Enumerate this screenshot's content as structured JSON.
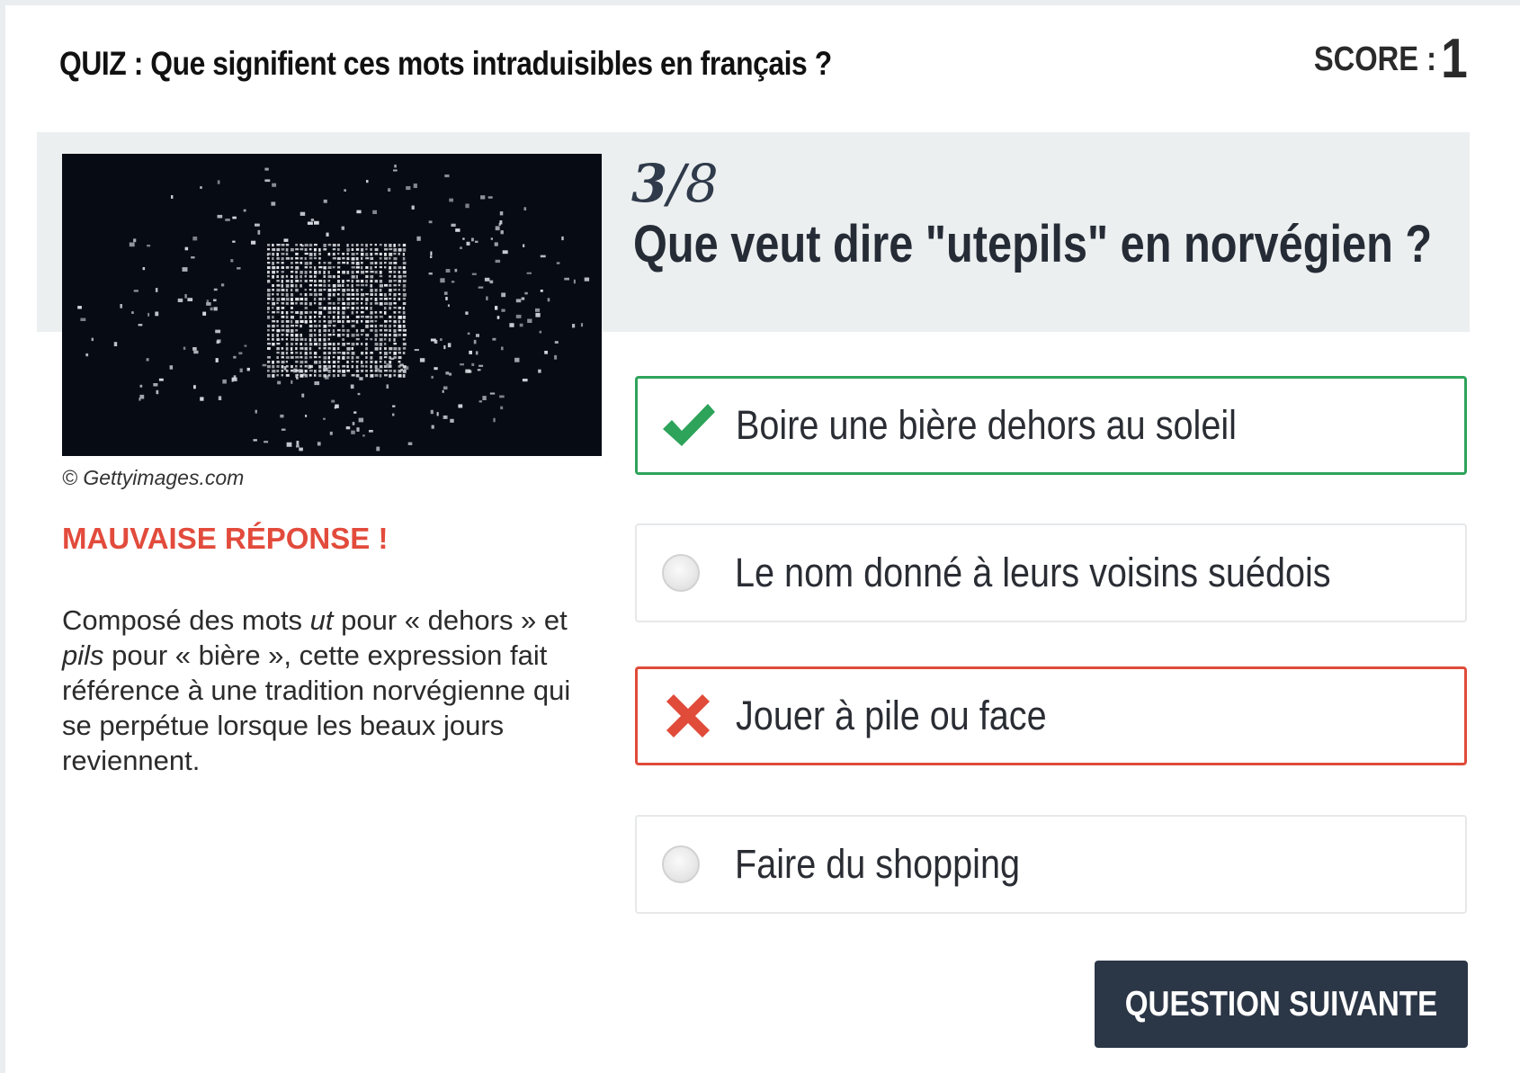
{
  "quiz": {
    "title": "QUIZ : Que signifient ces mots intraduisibles en français ?",
    "score_label": "SCORE :",
    "score_value": "1"
  },
  "question": {
    "current": "3",
    "total": "/8",
    "text": "Que veut dire \"utepils\" en norvégien ?",
    "image_credit": "© Gettyimages.com"
  },
  "feedback": {
    "verdict": "MAUVAISE RÉPONSE !",
    "explanation_parts": {
      "p1": "Composé des mots ",
      "em1": "ut",
      "p2": " pour « dehors » et ",
      "em2": "pils",
      "p3": " pour « bière », cette expression fait référence à une tradition norvégienne qui se perpétue lorsque les beaux jours reviennent."
    }
  },
  "answers": [
    {
      "label": "Boire une bière dehors au soleil",
      "state": "correct",
      "icon": "check-icon"
    },
    {
      "label": "Le nom donné à leurs voisins suédois",
      "state": "neutral",
      "icon": "radio-icon"
    },
    {
      "label": "Jouer à pile ou face",
      "state": "wrong",
      "icon": "cross-icon"
    },
    {
      "label": "Faire du shopping",
      "state": "neutral",
      "icon": "radio-icon"
    }
  ],
  "actions": {
    "next_label": "QUESTION SUIVANTE"
  },
  "colors": {
    "correct": "#2ea35a",
    "wrong": "#e04b3a",
    "verdict": "#e24b3c",
    "button_bg": "#2b3646",
    "band_bg": "#eceff0"
  }
}
